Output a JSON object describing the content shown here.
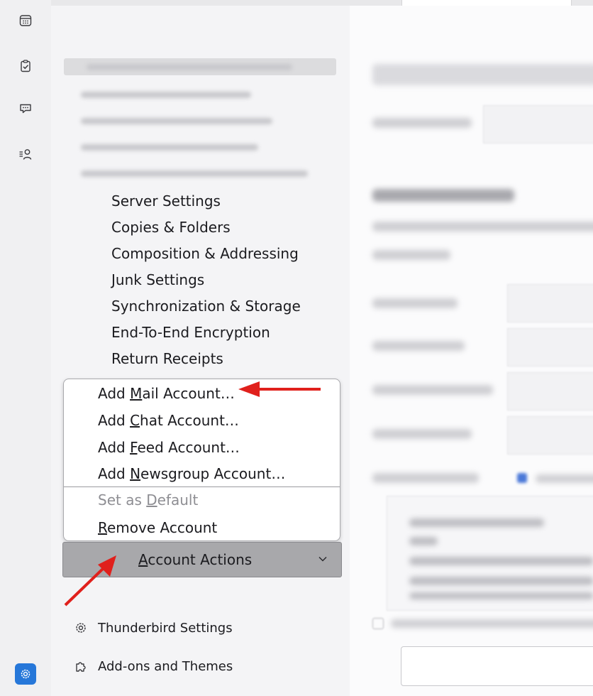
{
  "spaces_toolbar": {
    "items": [
      {
        "name": "calendar-icon"
      },
      {
        "name": "tasks-icon"
      },
      {
        "name": "chat-icon"
      },
      {
        "name": "address-book-icon"
      }
    ],
    "settings_icon": "settings-gear-icon",
    "accent_color": "#2677d9"
  },
  "sidebar": {
    "account_sub_items": [
      "Server Settings",
      "Copies & Folders",
      "Composition & Addressing",
      "Junk Settings",
      "Synchronization & Storage",
      "End-To-End Encryption",
      "Return Receipts"
    ]
  },
  "menu": {
    "items": [
      {
        "pre": "Add ",
        "key": "M",
        "post": "ail Account…",
        "enabled": true
      },
      {
        "pre": "Add ",
        "key": "C",
        "post": "hat Account…",
        "enabled": true
      },
      {
        "pre": "Add ",
        "key": "F",
        "post": "eed Account…",
        "enabled": true
      },
      {
        "pre": "Add ",
        "key": "N",
        "post": "ewsgroup Account…",
        "enabled": true
      },
      {
        "pre": "Set as ",
        "key": "D",
        "post": "efault",
        "enabled": false
      },
      {
        "pre": "",
        "key": "R",
        "post": "emove Account",
        "enabled": true
      }
    ]
  },
  "actions_button": {
    "key": "A",
    "rest": "ccount Actions"
  },
  "footer": {
    "settings_label": "Thunderbird Settings",
    "addons_label": "Add-ons and Themes"
  },
  "annotation_color": "#e0201c"
}
